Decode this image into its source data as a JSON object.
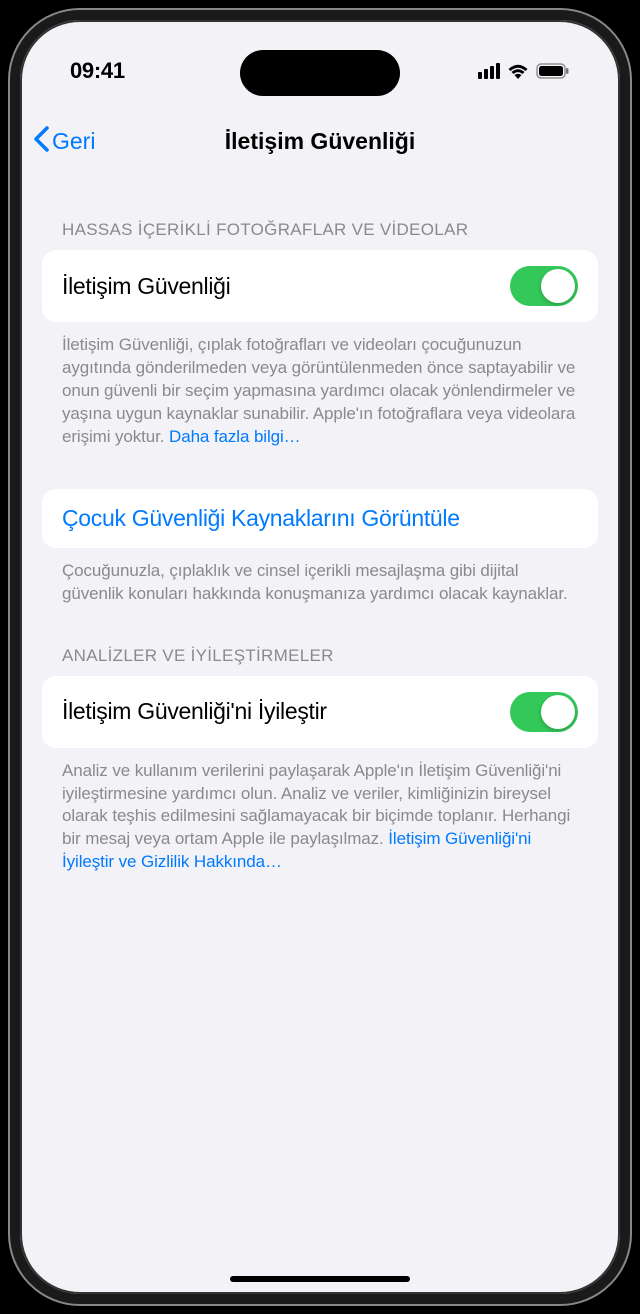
{
  "status": {
    "time": "09:41"
  },
  "nav": {
    "back_label": "Geri",
    "title": "İletişim Güvenliği"
  },
  "section1": {
    "header": "HASSAS İÇERİKLİ FOTOĞRAFLAR VE VİDEOLAR",
    "toggle_label": "İletişim Güvenliği",
    "toggle_on": true,
    "footer_text": "İletişim Güvenliği, çıplak fotoğrafları ve videoları çocuğunuzun aygıtında gönderilmeden veya görüntülenmeden önce saptayabilir ve onun güvenli bir seçim yapmasına yardımcı olacak yönlendirmeler ve yaşına uygun kaynaklar sunabilir. Apple'ın fotoğraflara veya videolara erişimi yoktur. ",
    "footer_link": "Daha fazla bilgi…"
  },
  "section2": {
    "link_label": "Çocuk Güvenliği Kaynaklarını Görüntüle",
    "footer_text": "Çocuğunuzla, çıplaklık ve cinsel içerikli mesajlaşma gibi dijital güvenlik konuları hakkında konuşmanıza yardımcı olacak kaynaklar."
  },
  "section3": {
    "header": "ANALİZLER VE İYİLEŞTİRMELER",
    "toggle_label": "İletişim Güvenliği'ni İyileştir",
    "toggle_on": true,
    "footer_text": "Analiz ve kullanım verilerini paylaşarak Apple'ın İletişim Güvenliği'ni iyileştirmesine yardımcı olun. Analiz ve veriler, kimliğinizin bireysel olarak teşhis edilmesini sağlamayacak bir biçimde toplanır. Herhangi bir mesaj veya ortam Apple ile paylaşılmaz. ",
    "footer_link": "İletişim Güvenliği'ni İyileştir ve Gizlilik Hakkında…"
  }
}
